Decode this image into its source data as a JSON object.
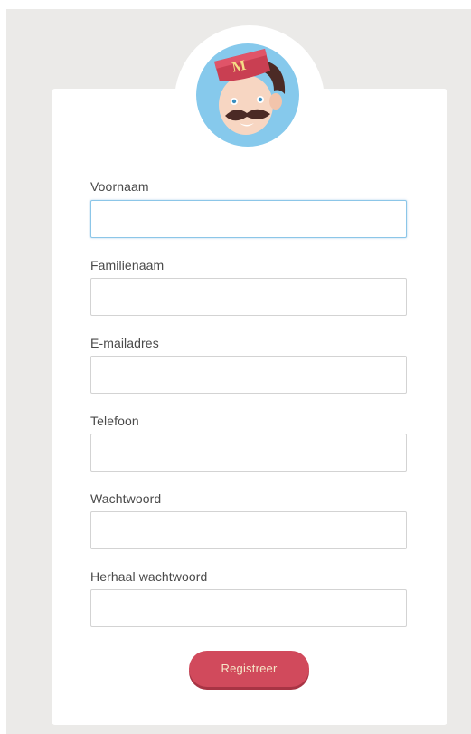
{
  "avatar": {
    "icon": "mascot-avatar-icon",
    "hat_letter": "M"
  },
  "form": {
    "fields": [
      {
        "label": "Voornaam",
        "value": "",
        "focused": true
      },
      {
        "label": "Familienaam",
        "value": "",
        "focused": false
      },
      {
        "label": "E-mailadres",
        "value": "",
        "focused": false
      },
      {
        "label": "Telefoon",
        "value": "",
        "focused": false
      },
      {
        "label": "Wachtwoord",
        "value": "",
        "focused": false
      },
      {
        "label": "Herhaal wachtwoord",
        "value": "",
        "focused": false
      }
    ],
    "submit_label": "Registreer"
  },
  "colors": {
    "background": "#ebeae8",
    "card": "#ffffff",
    "accent": "#d14a5c",
    "button_text": "#f6e7c9",
    "focus_border": "#8cc6e8"
  }
}
